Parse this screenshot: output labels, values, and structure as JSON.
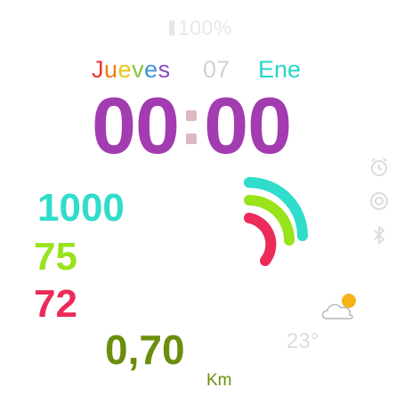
{
  "status": {
    "battery_text": "100%"
  },
  "date": {
    "weekday": "Jueves",
    "weekday_colors": [
      "#e53a2c",
      "#f07a1a",
      "#e8c417",
      "#8dc43f",
      "#3e96d8",
      "#8a4bc4"
    ],
    "day": "07",
    "month": "Ene",
    "month_color": "#26d7c8"
  },
  "time": {
    "hours": "00",
    "minutes": "00",
    "color": "#a33bb1"
  },
  "stats": {
    "steps": "1000",
    "steps_color": "#30dccb",
    "calories": "75",
    "calories_color": "#99e31c",
    "heart_rate": "72",
    "heart_rate_color": "#ec2b5a"
  },
  "distance": {
    "value": "0,70",
    "unit": "Km",
    "color": "#6b8e0e"
  },
  "weather": {
    "temperature": "23°",
    "icon": "partly-cloudy-icon"
  },
  "side_icons": [
    "alarm-icon",
    "target-icon",
    "bluetooth-icon"
  ],
  "rings": {
    "colors": [
      "#30dccb",
      "#99e31c",
      "#ec2b5a"
    ]
  }
}
